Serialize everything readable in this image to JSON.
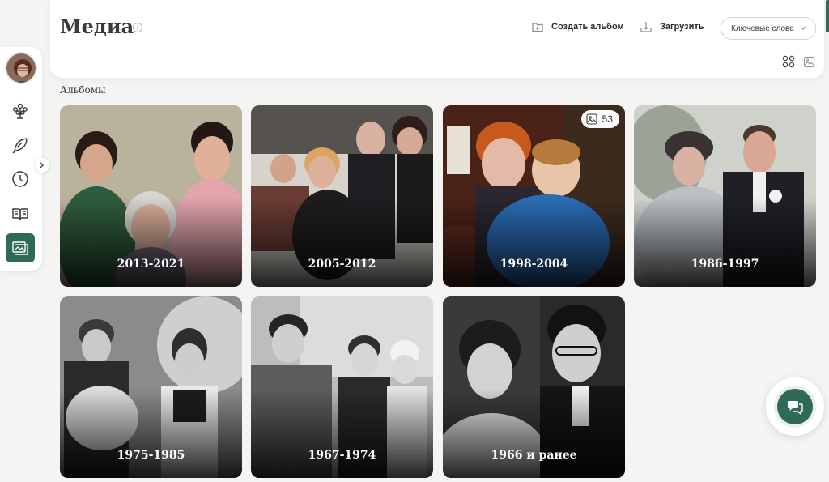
{
  "page": {
    "title": "Медиа",
    "section_label": "Альбомы"
  },
  "header": {
    "create_album_label": "Создать альбом",
    "upload_label": "Загрузить",
    "keywords_dropdown": "Ключевые слова"
  },
  "albums": [
    {
      "label": "2013-2021"
    },
    {
      "label": "2005-2012"
    },
    {
      "label": "1998-2004",
      "count": "53"
    },
    {
      "label": "1986-1997"
    },
    {
      "label": "1975-1985"
    },
    {
      "label": "1967-1974"
    },
    {
      "label": "1966 и ранее"
    }
  ],
  "sidebar": {
    "items": [
      {
        "icon": "family-tree-icon"
      },
      {
        "icon": "feather-icon"
      },
      {
        "icon": "clock-icon"
      },
      {
        "icon": "book-icon"
      },
      {
        "icon": "media-icon",
        "active": true
      }
    ]
  },
  "colors": {
    "accent": "#2f6a57",
    "background": "#f4f5f3"
  }
}
